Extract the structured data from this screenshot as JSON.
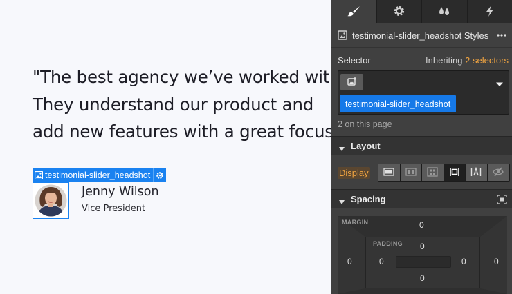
{
  "canvas": {
    "quote_lines": [
      "\"The best agency we’ve worked with.",
      "They understand our product and",
      "add new features with a great focus."
    ],
    "selected_label": "testimonial-slider_headshot",
    "person_name": "Jenny Wilson",
    "person_role": "Vice President"
  },
  "panel": {
    "tabs": [
      {
        "icon": "brush-icon"
      },
      {
        "icon": "gear-icon"
      },
      {
        "icon": "drops-icon"
      },
      {
        "icon": "lightning-icon"
      }
    ],
    "title": "testimonial-slider_headshot Styles",
    "selector": {
      "title": "Selector",
      "inheriting_prefix": "Inheriting",
      "inheriting_count": "2 selectors",
      "chip": "testimonial-slider_headshot",
      "on_page": "2 on this page"
    },
    "layout": {
      "heading": "Layout",
      "display_label": "Display",
      "display_options": [
        "block",
        "flex",
        "grid",
        "inline-block",
        "inline",
        "none"
      ],
      "display_active": "inline-block"
    },
    "spacing": {
      "heading": "Spacing",
      "margin_label": "MARGIN",
      "padding_label": "PADDING",
      "margin": {
        "top": "0",
        "right": "0",
        "bottom": "0",
        "left": "0"
      },
      "padding": {
        "top": "0",
        "right": "0",
        "bottom": "0",
        "left": "0"
      }
    },
    "colors": {
      "accent_blue": "#1679e8",
      "accent_orange": "#f0a441",
      "panel_bg": "#404040"
    }
  }
}
